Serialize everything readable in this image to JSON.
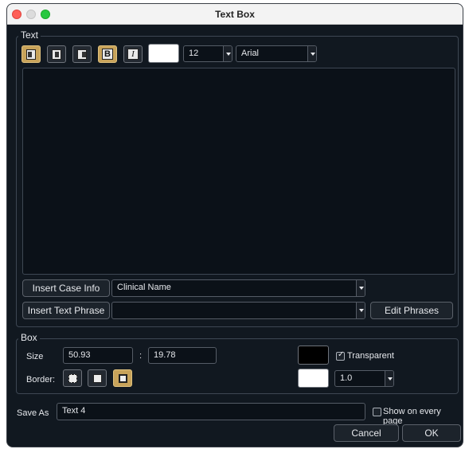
{
  "window": {
    "title": "Text Box"
  },
  "text_section": {
    "legend": "Text",
    "formatting": {
      "bold_label": "B",
      "italic_label": "I",
      "font_color": "#ffffff",
      "font_size": "12",
      "font_family": "Arial"
    },
    "case_info": {
      "button_label": "Insert Case Info",
      "selected": "Clinical Name"
    },
    "text_phrase": {
      "button_label": "Insert Text Phrase",
      "selected": "",
      "edit_label": "Edit Phrases"
    }
  },
  "box_section": {
    "legend": "Box",
    "size_label": "Size",
    "width": "50.93",
    "separator": ":",
    "height": "19.78",
    "fill_color": "#000000",
    "transparent_label": "Transparent",
    "transparent_checked": true,
    "border_label": "Border:",
    "border_color": "#ffffff",
    "border_width": "1.0"
  },
  "footer": {
    "save_as_label": "Save As",
    "save_as_value": "Text 4",
    "show_label": "Show on every page",
    "show_checked": false,
    "cancel_label": "Cancel",
    "ok_label": "OK"
  },
  "colors": {
    "accent": "#c8a35a",
    "window_bg": "#111820"
  }
}
